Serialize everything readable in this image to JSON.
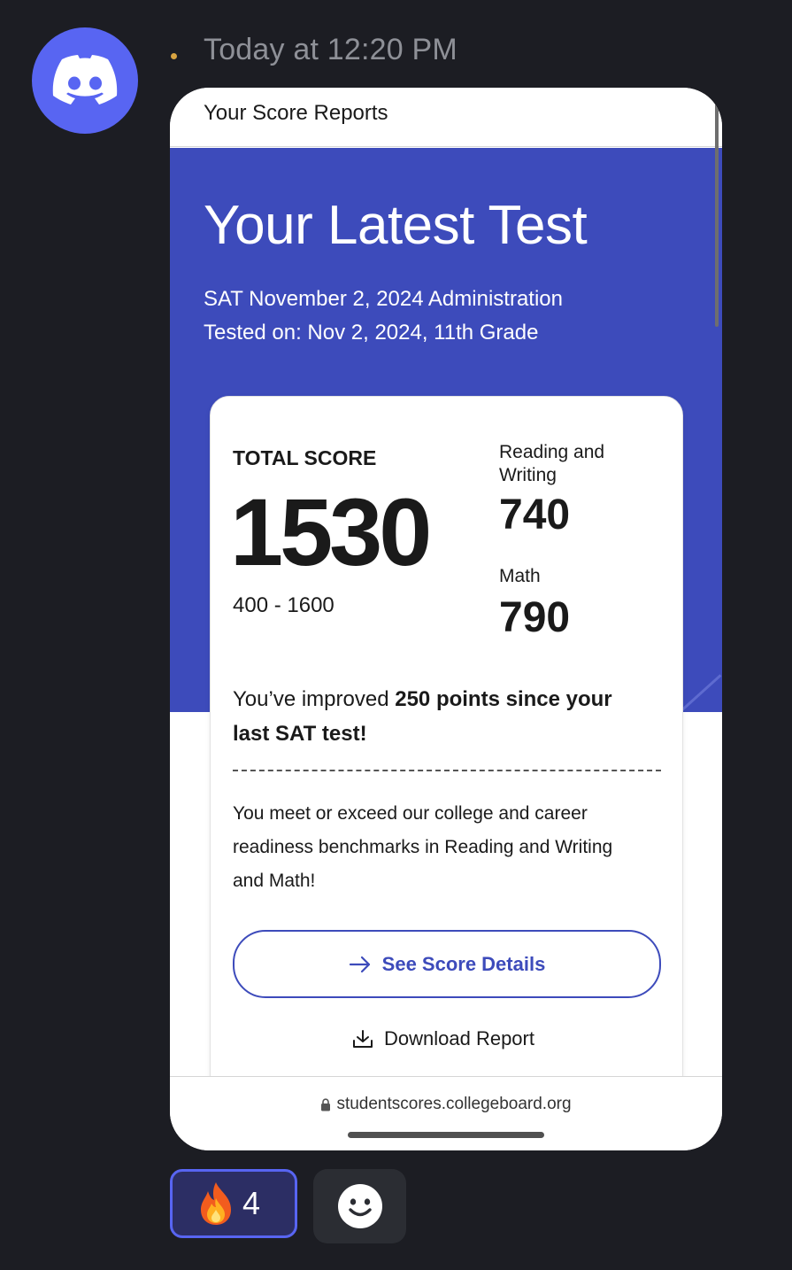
{
  "message": {
    "timestamp": "Today at 12:20 PM",
    "avatar_icon": "discord-logo-icon",
    "colors": {
      "avatar_bg": "#5865f2",
      "background": "#1c1d23"
    }
  },
  "screenshot": {
    "topbar_title": "Your Score Reports",
    "hero": {
      "title": "Your Latest Test",
      "subtitle_line1": "SAT November 2, 2024 Administration",
      "subtitle_line2": "Tested on: Nov 2, 2024, 11th Grade",
      "color": "#3d4bbb"
    },
    "score_card": {
      "total_label": "TOTAL SCORE",
      "total_value": "1530",
      "total_range": "400 - 1600",
      "rw_label": "Reading and Writing",
      "rw_value": "740",
      "math_label": "Math",
      "math_value": "790",
      "improve_prefix": "You’ve improved ",
      "improve_bold": "250 points since your last SAT test!",
      "benchmark_text": "You meet or exceed our college and career readiness benchmarks in Reading and Writing and Math!",
      "details_button": "See Score Details",
      "download_label": "Download Report"
    },
    "url": "studentscores.collegeboard.org"
  },
  "reactions": [
    {
      "emoji_icon": "fire-emoji-icon",
      "count": "4"
    }
  ],
  "add_reaction_icon": "add-reaction-smiley-icon"
}
